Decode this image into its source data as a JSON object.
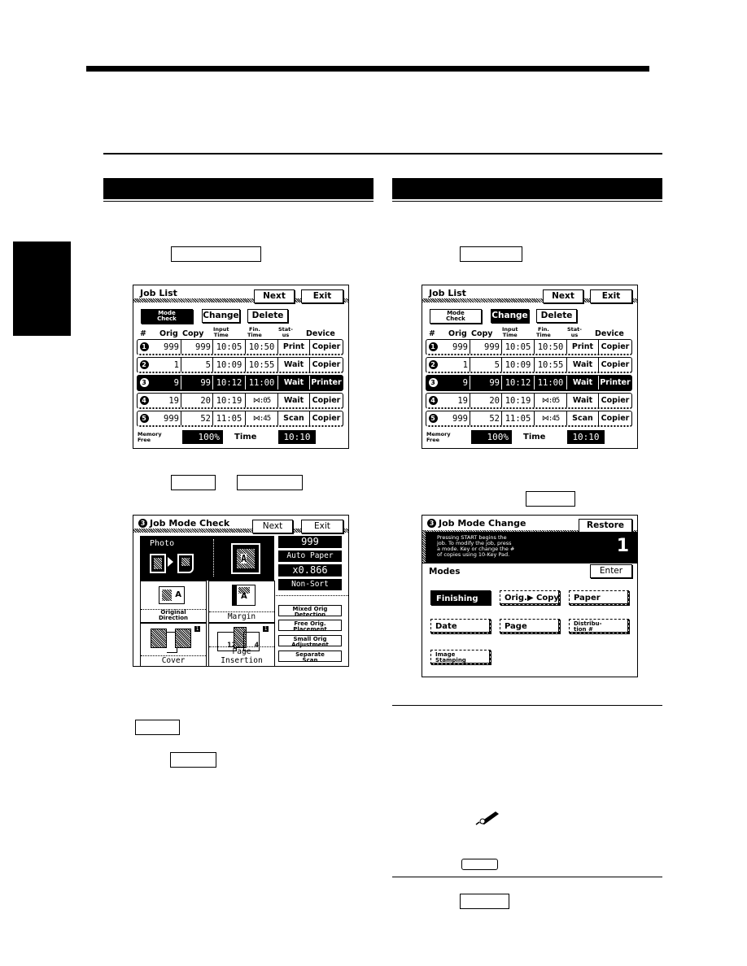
{
  "page": {
    "left_section_header": "",
    "right_section_header": ""
  },
  "job_list_left": {
    "title": "Job List",
    "next_label": "Next",
    "exit_label": "Exit",
    "mode_check_label_1": "Mode",
    "mode_check_label_2": "Check",
    "change_label": "Change",
    "delete_label": "Delete",
    "columns": {
      "num": "#",
      "orig": "Orig",
      "copy": "Copy",
      "input_1": "Input",
      "input_2": "Time",
      "fin_1": "Fin.",
      "fin_2": "Time",
      "status_1": "Stat-",
      "status_2": "us",
      "device": "Device"
    },
    "rows": [
      {
        "num": "1",
        "orig": "999",
        "copy": "999",
        "input_time": "10:05",
        "fin_time": "10:50",
        "status": "Print",
        "device": "Copier"
      },
      {
        "num": "2",
        "orig": "1",
        "copy": "5",
        "input_time": "10:09",
        "fin_time": "10:55",
        "status": "Wait",
        "device": "Copier"
      },
      {
        "num": "3",
        "orig": "9",
        "copy": "99",
        "input_time": "10:12",
        "fin_time": "11:00",
        "status": "Wait",
        "device": "Printer"
      },
      {
        "num": "4",
        "orig": "19",
        "copy": "20",
        "input_time": "10:19",
        "fin_time": "⋈:05",
        "status": "Wait",
        "device": "Copier"
      },
      {
        "num": "5",
        "orig": "999",
        "copy": "52",
        "input_time": "11:05",
        "fin_time": "⋈:45",
        "status": "Scan",
        "device": "Copier"
      }
    ],
    "memory_label_1": "Memory",
    "memory_label_2": "Free",
    "memory_value": "100%",
    "time_label": "Time",
    "time_value": "10:10"
  },
  "job_list_right": {
    "title": "Job List",
    "next_label": "Next",
    "exit_label": "Exit",
    "mode_check_label_1": "Mode",
    "mode_check_label_2": "Check",
    "change_label": "Change",
    "delete_label": "Delete",
    "columns": {
      "num": "#",
      "orig": "Orig",
      "copy": "Copy",
      "input_1": "Input",
      "input_2": "Time",
      "fin_1": "Fin.",
      "fin_2": "Time",
      "status_1": "Stat-",
      "status_2": "us",
      "device": "Device"
    },
    "rows": [
      {
        "num": "1",
        "orig": "999",
        "copy": "999",
        "input_time": "10:05",
        "fin_time": "10:50",
        "status": "Print",
        "device": "Copier"
      },
      {
        "num": "2",
        "orig": "1",
        "copy": "5",
        "input_time": "10:09",
        "fin_time": "10:55",
        "status": "Wait",
        "device": "Copier"
      },
      {
        "num": "3",
        "orig": "9",
        "copy": "99",
        "input_time": "10:12",
        "fin_time": "11:00",
        "status": "Wait",
        "device": "Printer"
      },
      {
        "num": "4",
        "orig": "19",
        "copy": "20",
        "input_time": "10:19",
        "fin_time": "⋈:05",
        "status": "Wait",
        "device": "Copier"
      },
      {
        "num": "5",
        "orig": "999",
        "copy": "52",
        "input_time": "11:05",
        "fin_time": "⋈:45",
        "status": "Scan",
        "device": "Copier"
      }
    ],
    "memory_label_1": "Memory",
    "memory_label_2": "Free",
    "memory_value": "100%",
    "time_label": "Time",
    "time_value": "10:10"
  },
  "job_mode_check": {
    "job_number": "3",
    "title": "Job Mode Check",
    "next_label": "Next",
    "exit_label": "Exit",
    "photo_label": "Photo",
    "copies": "999",
    "paper": "Auto Paper",
    "zoom": "x0.866",
    "sort": "Non-Sort",
    "original_direction_1": "Original",
    "original_direction_2": "Direction",
    "margin": "Margin",
    "cover": "Cover",
    "cover_badge": "1",
    "page_insertion": "Page Insertion",
    "page_insertion_badge": "1",
    "side_buttons": [
      {
        "line1": "Mixed Orig",
        "line2": "Detection"
      },
      {
        "line1": "Free Orig.",
        "line2": "Placement"
      },
      {
        "line1": "Small Orig",
        "line2": "Adjustment"
      },
      {
        "line1": "Separate",
        "line2": "Scan"
      }
    ]
  },
  "job_mode_change": {
    "job_number": "3",
    "title": "Job Mode Change",
    "restore_label": "Restore",
    "message_lines": [
      "Pressing START begins the",
      "job. To modify the job, press",
      "a mode. Key or change the #",
      "of copies using 10-Key Pad."
    ],
    "copies": "1",
    "modes_label": "Modes",
    "enter_label": "Enter",
    "modes": [
      {
        "line1": "Finishing",
        "line2": ""
      },
      {
        "line1": "Orig.▶ Copy",
        "line2": ""
      },
      {
        "line1": "Paper",
        "line2": ""
      },
      {
        "line1": "Date",
        "line2": ""
      },
      {
        "line1": "Page",
        "line2": ""
      },
      {
        "line1": "Distribu-",
        "line2": "tion #"
      },
      {
        "line1": "Image",
        "line2": "Stamping"
      }
    ]
  }
}
